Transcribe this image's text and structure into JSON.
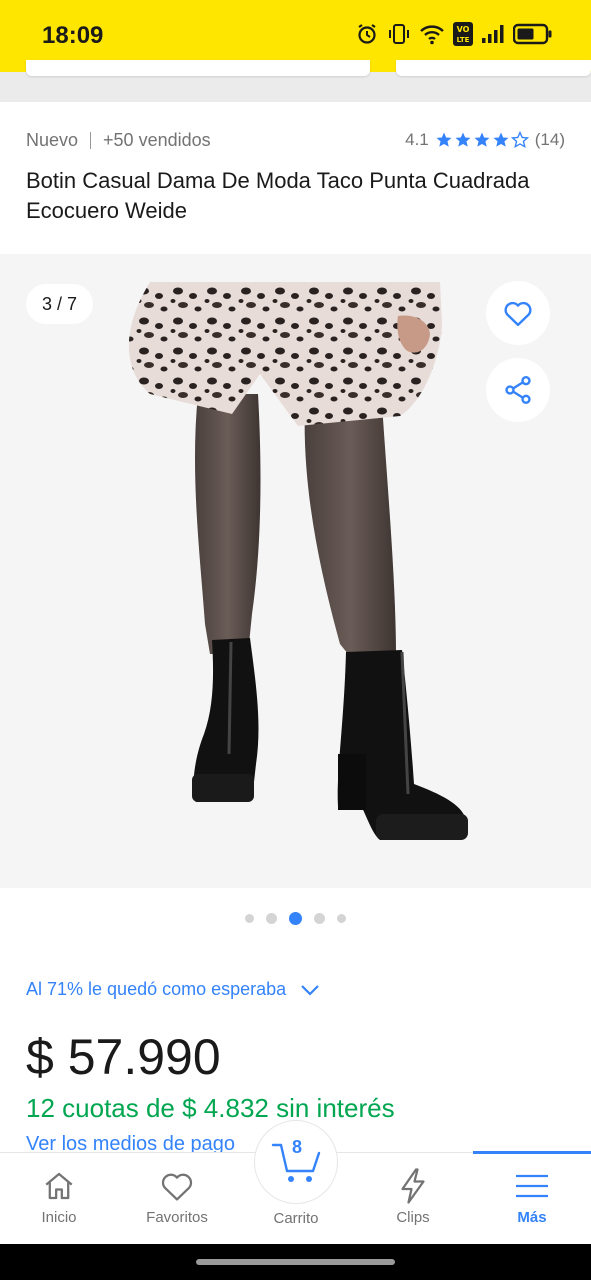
{
  "status_bar": {
    "time": "18:09",
    "icons": [
      "alarm-icon",
      "vibrate-icon",
      "wifi-icon",
      "volte-icon",
      "signal-icon",
      "battery-icon"
    ],
    "volte_text": "VO LTE"
  },
  "product": {
    "condition": "Nuevo",
    "sold": "+50 vendidos",
    "rating": "4.1",
    "rating_stars": 4,
    "reviews": "(14)",
    "title": "Botin Casual Dama De Moda Taco Punta Cuadrada Ecocuero Weide"
  },
  "gallery": {
    "counter": "3 / 7",
    "current_index": 3,
    "total_dots_shown": 5
  },
  "feedback": {
    "text": "Al 71% le quedó como esperaba"
  },
  "pricing": {
    "price": "$ 57.990",
    "installments": "12 cuotas de $ 4.832 sin interés",
    "payments_link": "Ver los medios de pago"
  },
  "bottom_nav": {
    "items": [
      {
        "label": "Inicio",
        "icon": "home-icon"
      },
      {
        "label": "Favoritos",
        "icon": "heart-icon"
      },
      {
        "label": "Carrito",
        "icon": "cart-icon"
      },
      {
        "label": "Clips",
        "icon": "lightning-icon"
      },
      {
        "label": "Más",
        "icon": "menu-icon"
      }
    ],
    "cart_count": "8",
    "active": "Más"
  },
  "colors": {
    "brand_yellow": "#ffe600",
    "accent_blue": "#3483fa",
    "success_green": "#00a650"
  }
}
